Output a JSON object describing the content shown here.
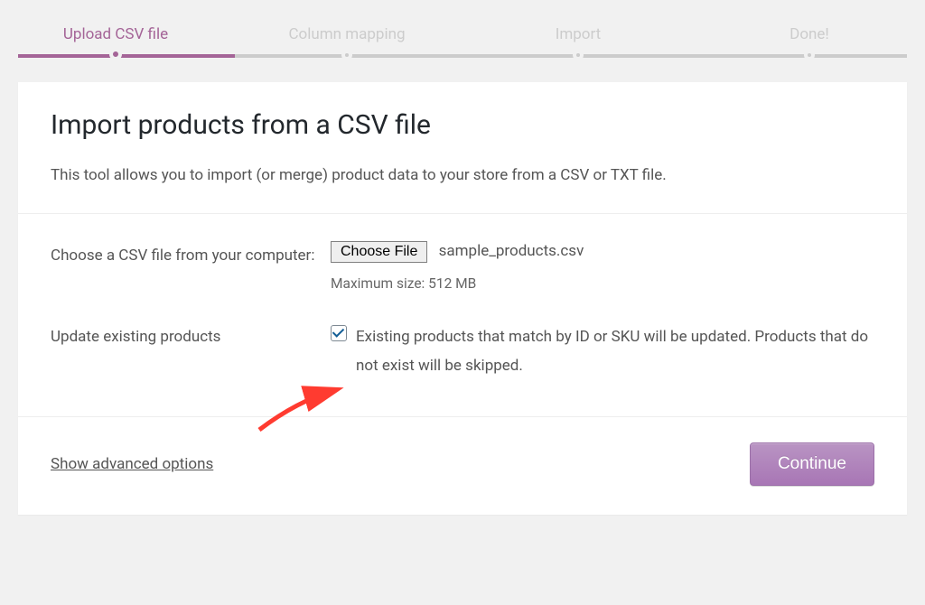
{
  "stepper": {
    "steps": [
      {
        "label": "Upload CSV file",
        "active": true
      },
      {
        "label": "Column mapping",
        "active": false
      },
      {
        "label": "Import",
        "active": false
      },
      {
        "label": "Done!",
        "active": false
      }
    ]
  },
  "page": {
    "title": "Import products from a CSV file",
    "description": "This tool allows you to import (or merge) product data to your store from a CSV or TXT file."
  },
  "form": {
    "file_label": "Choose a CSV file from your computer:",
    "choose_file_btn": "Choose File",
    "filename": "sample_products.csv",
    "max_size_hint": "Maximum size: 512 MB",
    "update_label": "Update existing products",
    "update_checked": true,
    "update_desc": "Existing products that match by ID or SKU will be updated. Products that do not exist will be skipped."
  },
  "footer": {
    "advanced_link": "Show advanced options",
    "continue_btn": "Continue"
  },
  "colors": {
    "accent": "#a46497"
  }
}
